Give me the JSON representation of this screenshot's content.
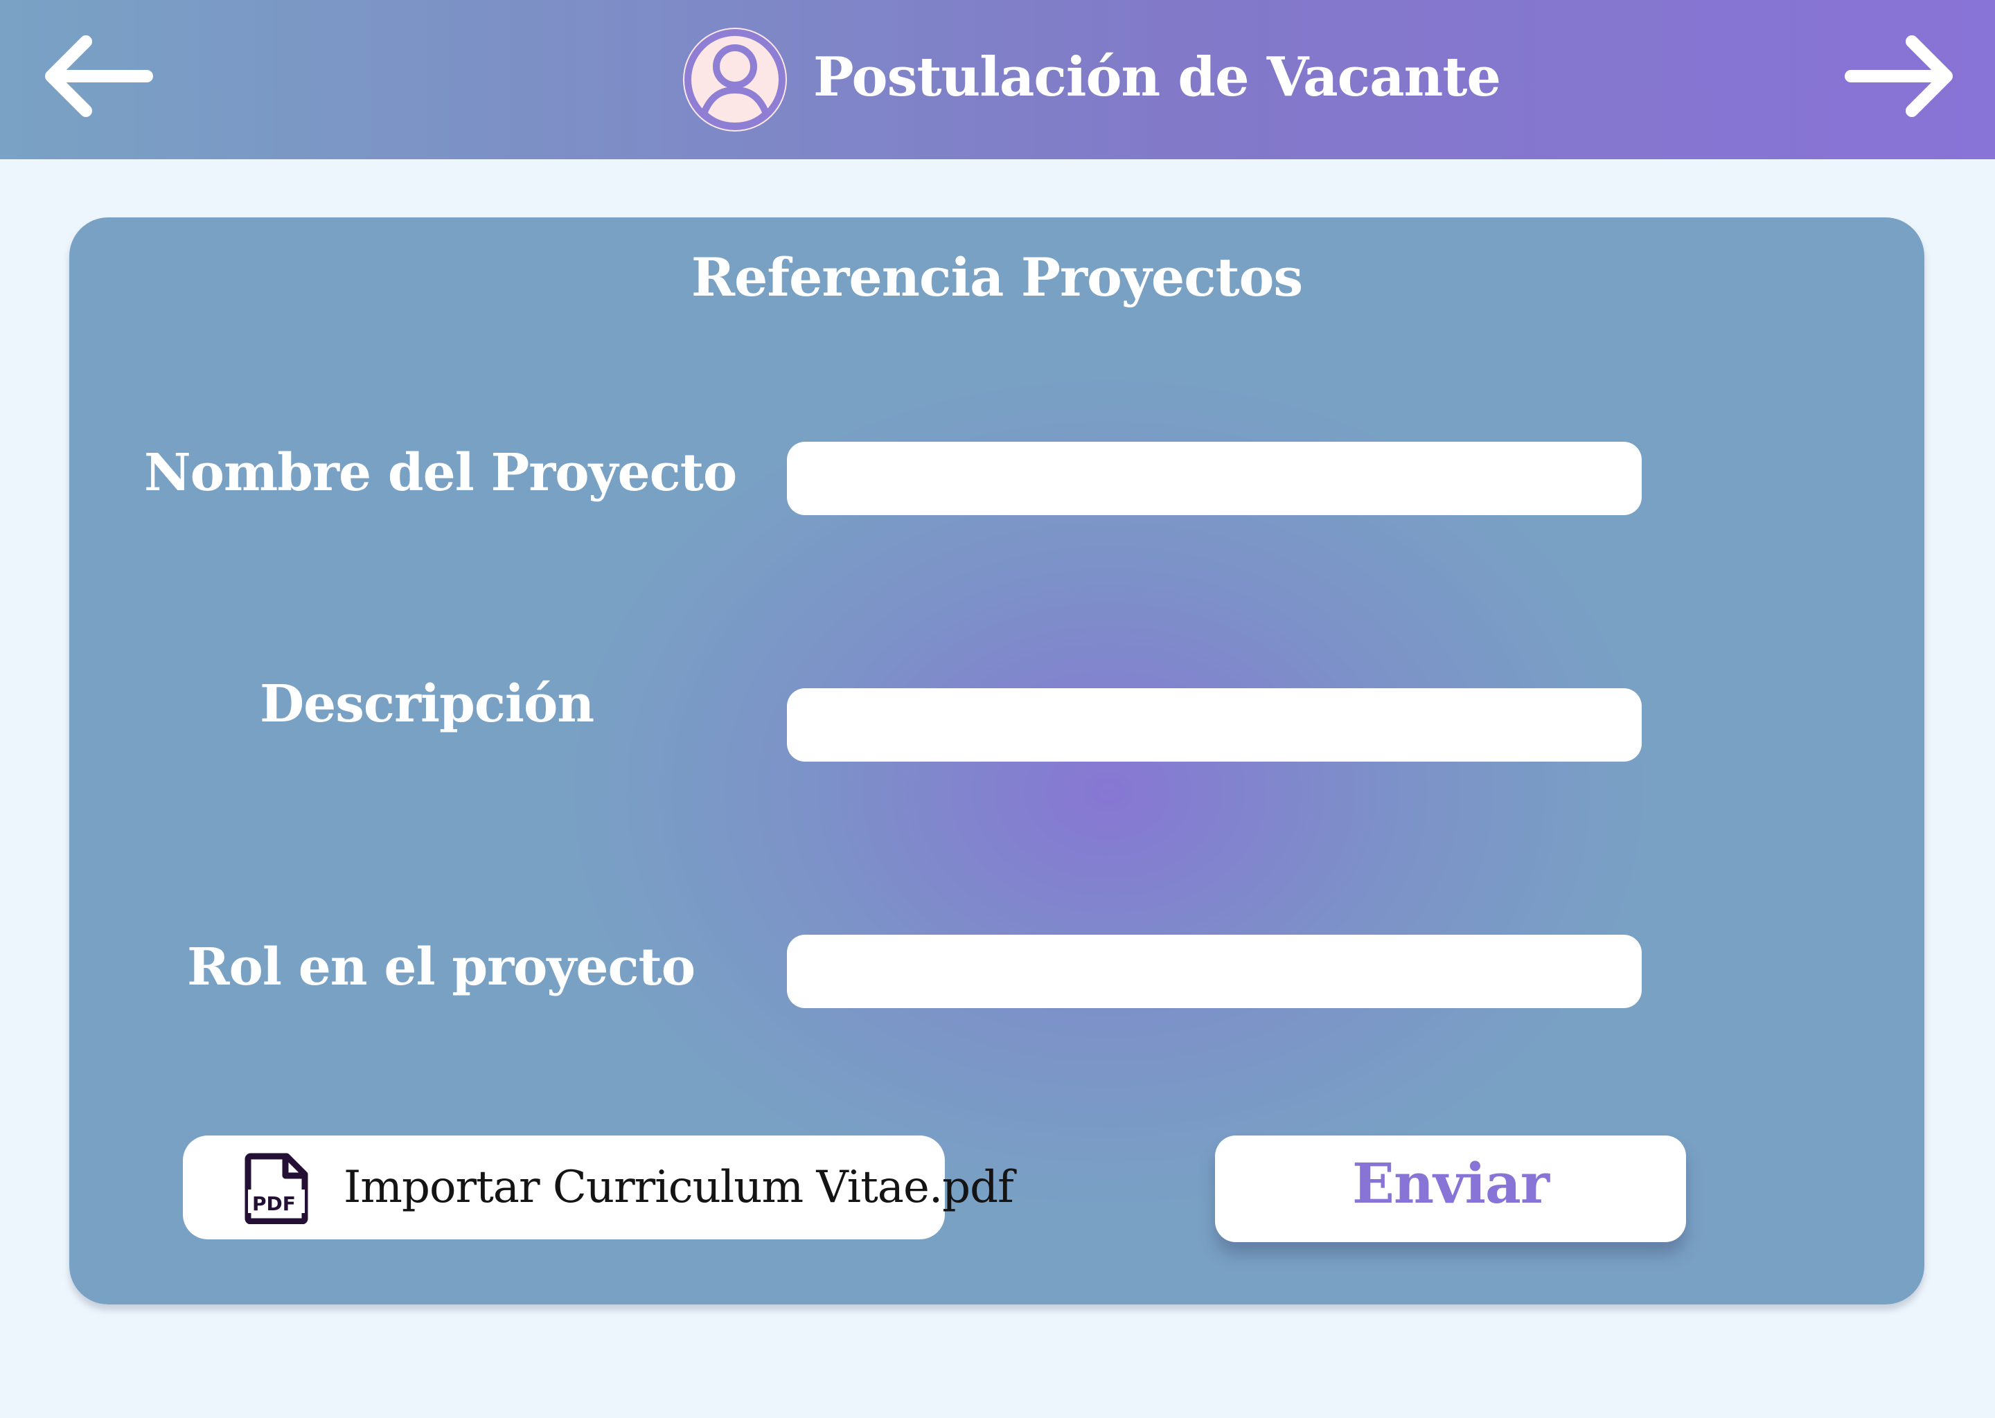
{
  "header": {
    "title": "Postulación de Vacante",
    "back_icon": "arrow-left-icon",
    "forward_icon": "arrow-right-icon",
    "avatar_icon": "user-avatar-icon"
  },
  "form": {
    "title": "Referencia Proyectos",
    "fields": [
      {
        "label": "Nombre del Proyecto",
        "value": "",
        "placeholder": ""
      },
      {
        "label": "Descripción",
        "value": "",
        "placeholder": ""
      },
      {
        "label": "Rol en el proyecto",
        "value": "",
        "placeholder": ""
      }
    ],
    "import_label": "Importar Curriculum Vitae.pdf",
    "import_icon": "pdf-file-icon",
    "submit_label": "Enviar"
  },
  "colors": {
    "header_gradient_start": "#79a2c4",
    "header_gradient_end": "#8873d6",
    "page_background": "#eef6fd",
    "accent": "#8873d6",
    "avatar_background": "#fde7e6"
  }
}
